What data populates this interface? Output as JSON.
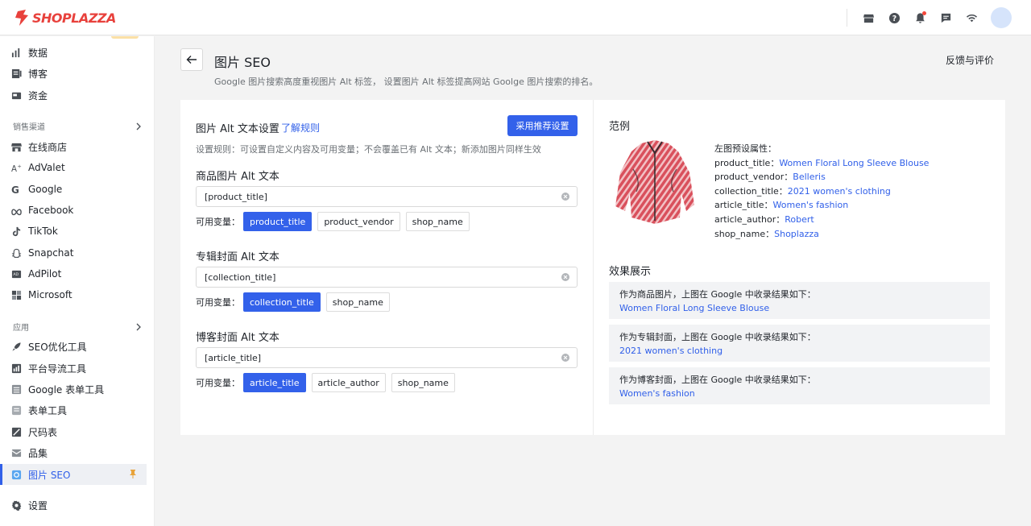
{
  "header": {
    "logo_text": "SHOPLAZZA",
    "icons": [
      "store-icon",
      "help-icon",
      "bell-icon",
      "message-icon",
      "wifi-icon"
    ],
    "brand_color": "#e8413c"
  },
  "sidebar": {
    "top_items": [
      {
        "label": "数据",
        "icon": "bar-chart-icon"
      },
      {
        "label": "博客",
        "icon": "blog-icon"
      },
      {
        "label": "资金",
        "icon": "wallet-icon"
      }
    ],
    "sales_section": "销售渠道",
    "sales_items": [
      {
        "label": "在线商店",
        "icon": "store-icon"
      },
      {
        "label": "AdValet",
        "icon": "advalet-icon"
      },
      {
        "label": "Google",
        "icon": "google-icon"
      },
      {
        "label": "Facebook",
        "icon": "meta-icon"
      },
      {
        "label": "TikTok",
        "icon": "tiktok-icon"
      },
      {
        "label": "Snapchat",
        "icon": "snapchat-icon"
      },
      {
        "label": "AdPilot",
        "icon": "adpilot-icon"
      },
      {
        "label": "Microsoft",
        "icon": "microsoft-icon"
      }
    ],
    "apps_section": "应用",
    "app_items": [
      {
        "label": "SEO优化工具",
        "icon": "rocket-icon"
      },
      {
        "label": "平台导流工具",
        "icon": "traffic-icon"
      },
      {
        "label": "Google 表单工具",
        "icon": "sheet-icon"
      },
      {
        "label": "表单工具",
        "icon": "form-icon"
      },
      {
        "label": "尺码表",
        "icon": "ruler-icon"
      },
      {
        "label": "品集",
        "icon": "collection-icon"
      },
      {
        "label": "图片 SEO",
        "icon": "image-seo-icon",
        "active": true
      }
    ],
    "settings_label": "设置",
    "accent_color": "#3160e9"
  },
  "page": {
    "title": "图片 SEO",
    "description": "Google 图片搜索高度重视图片 Alt 标签， 设置图片 Alt 标签提高网站 Goolge 图片搜索的排名。",
    "feedback": "反馈与评价"
  },
  "settings_panel": {
    "title": "图片 Alt 文本设置",
    "rules_link": "了解规则",
    "apply_button": "采用推荐设置",
    "rule_text": "设置规则：可设置自定义内容及可用变量；不会覆盖已有 Alt 文本；新添加图片同样生效",
    "var_label": "可用变量：",
    "fields": [
      {
        "label": "商品图片 Alt 文本",
        "value": "[product_title]",
        "vars": [
          {
            "name": "product_title",
            "selected": true
          },
          {
            "name": "product_vendor",
            "selected": false
          },
          {
            "name": "shop_name",
            "selected": false
          }
        ]
      },
      {
        "label": "专辑封面 Alt 文本",
        "value": "[collection_title]",
        "vars": [
          {
            "name": "collection_title",
            "selected": true
          },
          {
            "name": "shop_name",
            "selected": false
          }
        ]
      },
      {
        "label": "博客封面 Alt 文本",
        "value": "[article_title]",
        "vars": [
          {
            "name": "article_title",
            "selected": true
          },
          {
            "name": "article_author",
            "selected": false
          },
          {
            "name": "shop_name",
            "selected": false
          }
        ]
      }
    ]
  },
  "example_panel": {
    "title": "范例",
    "attrs_heading": "左图预设属性：",
    "attrs": [
      {
        "key": "product_title：",
        "value": "Women Floral Long Sleeve Blouse"
      },
      {
        "key": "product_vendor：",
        "value": "Belleris"
      },
      {
        "key": "collection_title：",
        "value": "2021 women's clothing"
      },
      {
        "key": "article_title：",
        "value": "Women's fashion"
      },
      {
        "key": "article_author：",
        "value": "Robert"
      },
      {
        "key": "shop_name：",
        "value": "Shoplazza"
      }
    ],
    "results_title": "效果展示",
    "results": [
      {
        "heading": "作为商品图片，上图在 Google 中收录结果如下：",
        "value": "Women Floral Long Sleeve Blouse"
      },
      {
        "heading": "作为专辑封面，上图在 Google 中收录结果如下：",
        "value": "2021 women's clothing"
      },
      {
        "heading": "作为博客封面，上图在 Google 中收录结果如下：",
        "value": "Women's fashion"
      }
    ]
  }
}
